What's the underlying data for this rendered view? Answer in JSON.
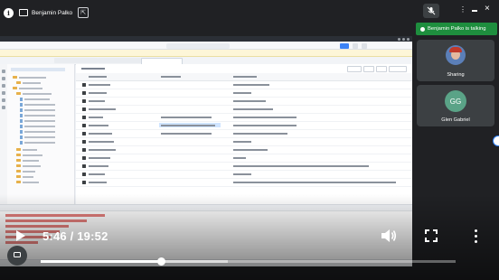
{
  "meeting": {
    "presenter_name": "Benjamin Palko",
    "speaking_label": "Benjamin Palko is talking",
    "participants": [
      {
        "name": "Sharing",
        "initials": ""
      },
      {
        "name": "Glen Gabriel",
        "initials": "GG"
      }
    ]
  },
  "player": {
    "time_display": "5:46 / 19:52",
    "progress": 0.29,
    "buffered": 0.45
  },
  "colors": {
    "speaking_green": "#1e8e3e",
    "tile_bg": "#3c4043",
    "gg_avatar": "#5aa387",
    "accent_blue": "#2d7ff9"
  },
  "icons": {
    "info": "info-icon",
    "present": "screen-share-icon",
    "popout": "popout-icon",
    "mic_off": "mic-off-icon",
    "more": "more-vertical-icon",
    "volume": "volume-icon",
    "fullscreen": "fullscreen-icon",
    "captions": "captions-icon",
    "play": "play-icon"
  }
}
